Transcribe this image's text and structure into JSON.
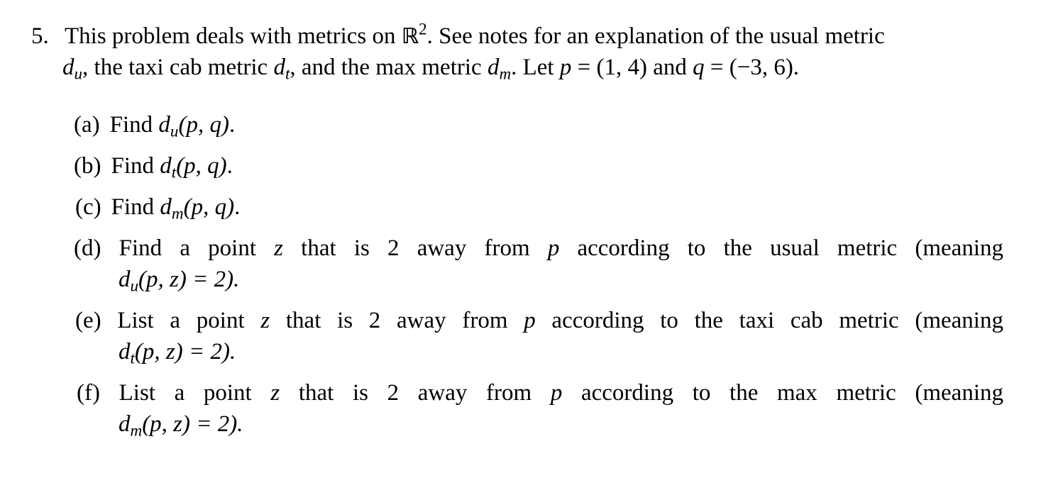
{
  "problem": {
    "number": "5.",
    "intro_line1": {
      "pre": "This problem deals with metrics on ",
      "set_symbol": "ℝ",
      "set_exp": "2",
      "post": ". See notes for an explanation of the usual metric"
    },
    "intro_line2": {
      "d": "d",
      "u_sub": "u",
      "t1": ", the taxi cab metric ",
      "t_sub": "t",
      "t2": ", and the max metric ",
      "m_sub": "m",
      "t3": ". Let ",
      "p": "p",
      "p_val": " = (1, 4) and ",
      "q": "q",
      "q_val": " = (−3, 6)."
    },
    "parts": [
      {
        "label": "(a)",
        "text": "Find ",
        "sub": "u",
        "args": "(p, q)",
        "end": "."
      },
      {
        "label": "(b)",
        "text": "Find ",
        "sub": "t",
        "args": "(p, q)",
        "end": "."
      },
      {
        "label": "(c)",
        "text": "Find ",
        "sub": "m",
        "args": "(p, q)",
        "end": "."
      },
      {
        "label": "(d)",
        "line1_pre": "Find a point ",
        "z": "z",
        "line1_mid": " that is 2 away from ",
        "p": "p",
        "line1_post": " according to the usual metric (meaning",
        "sub": "u",
        "line2": "(p, z) = 2)."
      },
      {
        "label": "(e)",
        "line1_pre": "List a point ",
        "z": "z",
        "line1_mid": " that is 2 away from ",
        "p": "p",
        "line1_post": " according to the taxi cab metric (meaning",
        "sub": "t",
        "line2": "(p, z) = 2)."
      },
      {
        "label": "(f)",
        "line1_pre": "List a point ",
        "z": "z",
        "line1_mid": " that is 2 away from ",
        "p": "p",
        "line1_post": " according to the max metric (meaning",
        "sub": "m",
        "line2": "(p, z) = 2)."
      }
    ]
  }
}
